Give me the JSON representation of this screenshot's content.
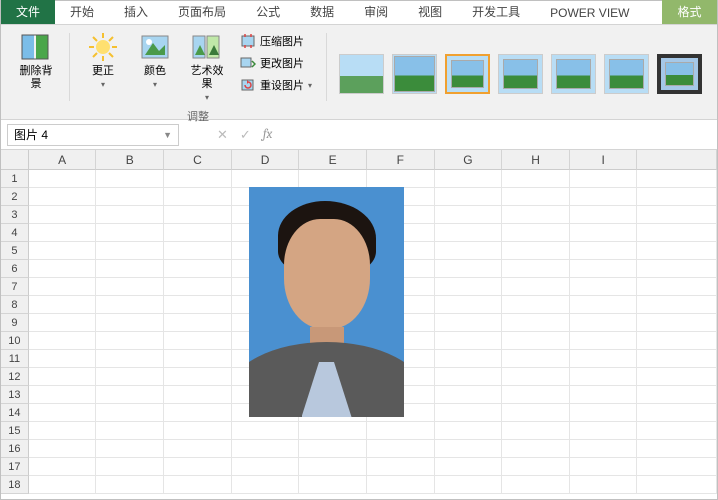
{
  "tabs": {
    "file": "文件",
    "home": "开始",
    "insert": "插入",
    "layout": "页面布局",
    "formula": "公式",
    "data": "数据",
    "review": "审阅",
    "view": "视图",
    "dev": "开发工具",
    "power": "POWER VIEW",
    "format": "格式"
  },
  "ribbon": {
    "remove_bg": "删除背景",
    "corrections": "更正",
    "color": "颜色",
    "artistic": "艺术效果",
    "compress": "压缩图片",
    "change": "更改图片",
    "reset": "重设图片",
    "adjust_group": "调整"
  },
  "namebox": "图片 4",
  "fx": {
    "cancel": "✕",
    "confirm": "✓",
    "fx": "fx"
  },
  "columns": [
    "A",
    "B",
    "C",
    "D",
    "E",
    "F",
    "G",
    "H",
    "I"
  ],
  "rows": [
    "1",
    "2",
    "3",
    "4",
    "5",
    "6",
    "7",
    "8",
    "9",
    "10",
    "11",
    "12",
    "13",
    "14",
    "15",
    "16",
    "17",
    "18"
  ],
  "embedded": {
    "name": "图片 4"
  }
}
